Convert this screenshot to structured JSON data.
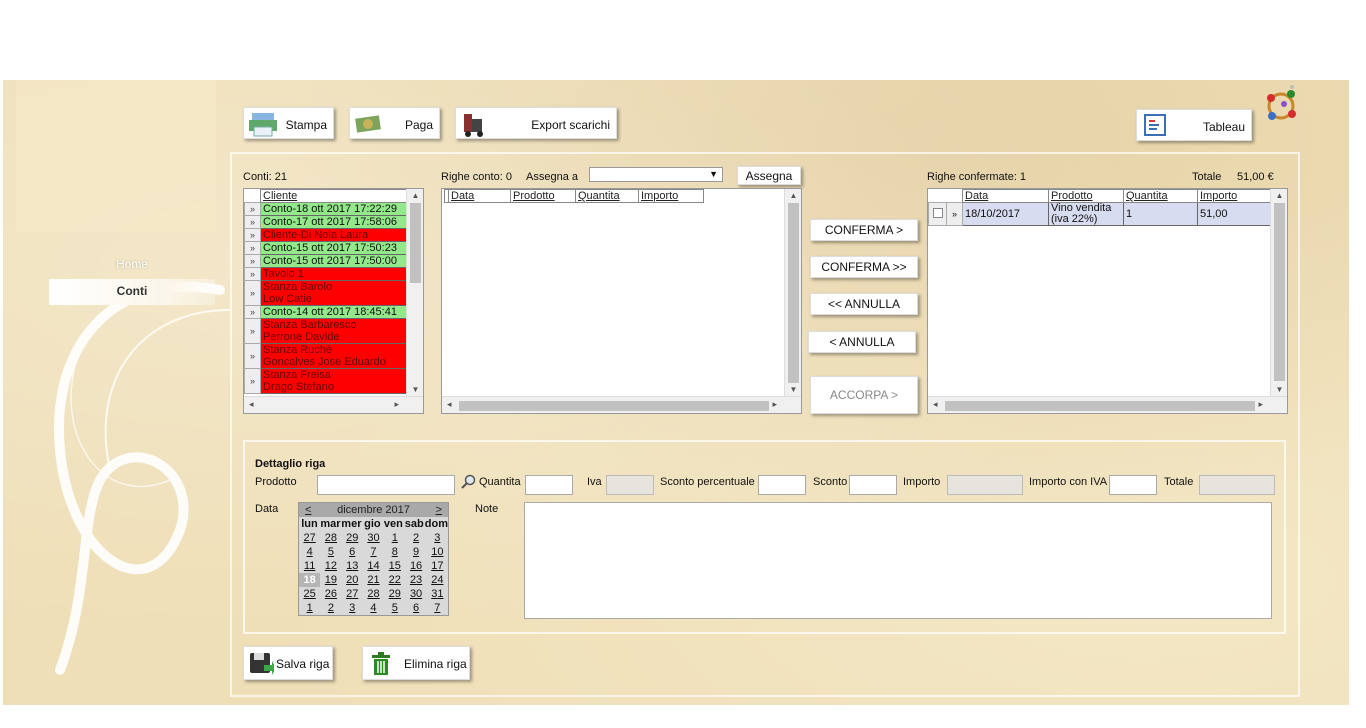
{
  "nav": {
    "home": "Home",
    "conti": "Conti"
  },
  "toolbar": {
    "stampa": "Stampa",
    "paga": "Paga",
    "export": "Export scarichi",
    "tableau": "Tableau"
  },
  "conti": {
    "count_label": "Conti: 21",
    "column": "Cliente",
    "rows": [
      {
        "lines": [
          "Conto-18 ott 2017 17:22:29"
        ],
        "status": "green"
      },
      {
        "lines": [
          "Conto-17 ott 2017 17:58:06"
        ],
        "status": "green"
      },
      {
        "lines": [
          "Cliente-Di Noia Laura"
        ],
        "status": "red"
      },
      {
        "lines": [
          "Conto-15 ott 2017 17:50:23"
        ],
        "status": "green"
      },
      {
        "lines": [
          "Conto-15 ott 2017 17:50:00"
        ],
        "status": "green"
      },
      {
        "lines": [
          "Tavolo 1"
        ],
        "status": "red"
      },
      {
        "lines": [
          "Stanza Barolo",
          "Low Catie"
        ],
        "status": "red"
      },
      {
        "lines": [
          "Conto-14 ott 2017 18:45:41"
        ],
        "status": "green"
      },
      {
        "lines": [
          "Stanza Barbaresco",
          "Perrone Davide"
        ],
        "status": "red"
      },
      {
        "lines": [
          "Stanza Ruchè",
          "Goncalves Jose Eduardo"
        ],
        "status": "red"
      },
      {
        "lines": [
          "Stanza Freisa",
          "Drago Stefano"
        ],
        "status": "red"
      }
    ]
  },
  "righe_conto": {
    "count_label": "Righe conto: 0",
    "assegna_label": "Assegna a",
    "assegna_value": "",
    "assegna_button": "Assegna",
    "columns": [
      "Data",
      "Prodotto",
      "Quantita",
      "Importo"
    ]
  },
  "actions": {
    "conferma": "CONFERMA >",
    "conferma_all": "CONFERMA >>",
    "annulla_all": "<< ANNULLA",
    "annulla": "< ANNULLA",
    "accorpa": "ACCORPA >"
  },
  "righe_confermate": {
    "count_label": "Righe confermate: 1",
    "totale_label": "Totale",
    "totale_value": "51,00 €",
    "columns": [
      "Data",
      "Prodotto",
      "Quantita",
      "Importo"
    ],
    "rows": [
      {
        "data": "18/10/2017",
        "prodotto_1": "Vino vendita",
        "prodotto_2": "(iva 22%)",
        "quantita": "1",
        "importo": "51,00"
      }
    ]
  },
  "dettaglio": {
    "title": "Dettaglio riga",
    "prodotto": "Prodotto",
    "quantita": "Quantita",
    "iva": "Iva",
    "sconto_percentuale": "Sconto percentuale",
    "sconto": "Sconto",
    "importo": "Importo",
    "importo_iva": "Importo con IVA",
    "totale": "Totale",
    "data": "Data",
    "note": "Note"
  },
  "calendar": {
    "prev": "<",
    "next": ">",
    "month": "dicembre 2017",
    "weekdays": [
      "lun",
      "mar",
      "mer",
      "gio",
      "ven",
      "sab",
      "dom"
    ],
    "days": [
      "27",
      "28",
      "29",
      "30",
      "1",
      "2",
      "3",
      "4",
      "5",
      "6",
      "7",
      "8",
      "9",
      "10",
      "11",
      "12",
      "13",
      "14",
      "15",
      "16",
      "17",
      "18",
      "19",
      "20",
      "21",
      "22",
      "23",
      "24",
      "25",
      "26",
      "27",
      "28",
      "29",
      "30",
      "31",
      "1",
      "2",
      "3",
      "4",
      "5",
      "6",
      "7"
    ],
    "selected_day": "18"
  },
  "footer": {
    "salva": "Salva riga",
    "elimina": "Elimina riga"
  }
}
